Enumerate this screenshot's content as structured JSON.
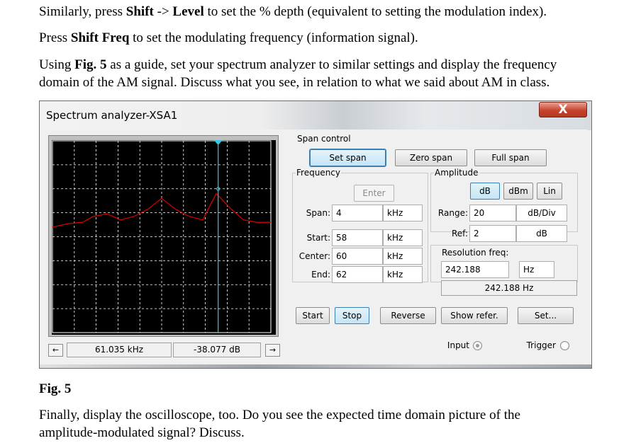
{
  "doc": {
    "p1": {
      "a": "Similarly, press ",
      "b1": "Shift",
      "c": " -> ",
      "b2": "Level",
      "d": " to set the % depth (equivalent to setting the modulation index)."
    },
    "p2": {
      "a": "Press ",
      "b1": "Shift Freq",
      "c": " to set the modulating frequency (information signal)."
    },
    "p3": {
      "a": "Using ",
      "b1": "Fig. 5",
      "c": " as a guide, set your spectrum analyzer to similar settings and display the frequency",
      "line2": "domain of the AM signal. Discuss what you see, in relation to what we said about AM in class."
    },
    "caption": "Fig. 5",
    "p4": {
      "line1": "Finally, display the oscilloscope, too. Do you see the expected time domain picture of the",
      "line2": "amplitude-modulated signal? Discuss."
    }
  },
  "window": {
    "title": "Spectrum analyzer-XSA1",
    "close_glyph": "X"
  },
  "readout": {
    "left_arrow": "←",
    "right_arrow": "→",
    "frequency": "61.035 kHz",
    "level": "-38.077  dB"
  },
  "span_control": {
    "label": "Span control",
    "set_span": "Set span",
    "zero_span": "Zero span",
    "full_span": "Full span"
  },
  "frequency": {
    "label": "Frequency",
    "enter": "Enter",
    "span_label": "Span:",
    "span_value": "4",
    "span_unit": "kHz",
    "start_label": "Start:",
    "start_value": "58",
    "start_unit": "kHz",
    "center_label": "Center:",
    "center_value": "60",
    "center_unit": "kHz",
    "end_label": "End:",
    "end_value": "62",
    "end_unit": "kHz"
  },
  "amplitude": {
    "label": "Amplitude",
    "db": "dB",
    "dbm": "dBm",
    "lin": "Lin",
    "range_label": "Range:",
    "range_value": "20",
    "range_unit": "dB/Div",
    "ref_label": "Ref:",
    "ref_value": "2",
    "ref_unit": "dB"
  },
  "resolution": {
    "label": "Resolution freq:",
    "value": "242.188",
    "unit": "Hz",
    "display": "242.188  Hz"
  },
  "buttons": {
    "start": "Start",
    "stop": "Stop",
    "reverse": "Reverse",
    "show_refer": "Show refer.",
    "set": "Set..."
  },
  "io": {
    "input": "Input",
    "trigger": "Trigger"
  },
  "colors": {
    "trace": "#d40000",
    "cursor": "#35c8e0",
    "grid": "#ffffff",
    "screen_bg": "#000000"
  },
  "chart_data": {
    "type": "line",
    "x_unit": "kHz",
    "xlim": [
      58,
      62
    ],
    "y_unit": "dB",
    "ylim": [
      -158,
      2
    ],
    "y_div": 20,
    "grid": true,
    "cursor_x": 61.035,
    "cursor_y": -38.077,
    "x": [
      58.0,
      58.3,
      58.55,
      58.75,
      59.0,
      59.25,
      59.5,
      59.75,
      60.0,
      60.25,
      60.5,
      60.75,
      61.0,
      61.25,
      61.5,
      61.75,
      62.0
    ],
    "y": [
      -70,
      -67,
      -66,
      -61,
      -59,
      -64,
      -61,
      -55,
      -46,
      -55,
      -61,
      -64,
      -42,
      -54,
      -64,
      -66,
      -66
    ]
  }
}
